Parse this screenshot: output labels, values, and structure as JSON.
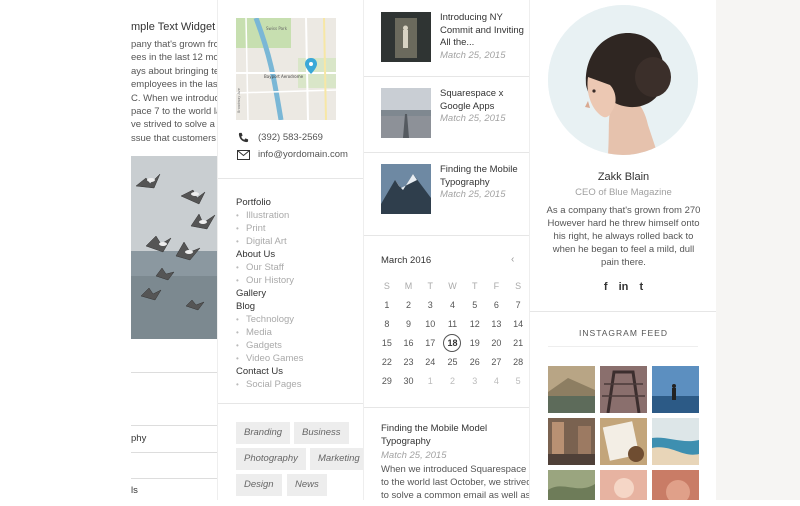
{
  "widget": {
    "title": "mple Text Widget",
    "lines": [
      "pany that's grown fro",
      "ees in the last 12 mo",
      "ays about bringing te",
      "employees in the last",
      "C. When we introduc",
      "pace 7 to the world las",
      "ve strived to solve a",
      "ssue that customers"
    ]
  },
  "left_rows": [
    "",
    "phy",
    "",
    "ls"
  ],
  "contact": {
    "phone": "(392) 583-2569",
    "email": "info@yordomain.com"
  },
  "map_labels": {
    "park": "Swiss Park",
    "airport": "Bayport Aerodrome",
    "road": "Broadway Ave"
  },
  "menu": [
    {
      "label": "Portfolio",
      "type": "main"
    },
    {
      "label": "Illustration",
      "type": "sub"
    },
    {
      "label": "Print",
      "type": "sub"
    },
    {
      "label": "Digital Art",
      "type": "sub"
    },
    {
      "label": "About Us",
      "type": "main"
    },
    {
      "label": "Our Staff",
      "type": "sub"
    },
    {
      "label": "Our History",
      "type": "sub"
    },
    {
      "label": "Gallery",
      "type": "main"
    },
    {
      "label": "Blog",
      "type": "main"
    },
    {
      "label": "Technology",
      "type": "sub"
    },
    {
      "label": "Media",
      "type": "sub"
    },
    {
      "label": "Gadgets",
      "type": "sub"
    },
    {
      "label": "Video Games",
      "type": "sub"
    },
    {
      "label": "Contact Us",
      "type": "main"
    },
    {
      "label": "Social Pages",
      "type": "sub"
    }
  ],
  "tags": [
    "Branding",
    "Business",
    "Photography",
    "Marketing",
    "Design",
    "News"
  ],
  "posts": [
    {
      "title": "Introducing NY Commit and Inviting All the...",
      "date": "Match 25, 2015"
    },
    {
      "title": "Squarespace x Google Apps",
      "date": "Match 25, 2015"
    },
    {
      "title": "Finding the Mobile Typography",
      "date": "Match 25, 2015"
    }
  ],
  "calendar": {
    "title": "March 2016",
    "prev": "‹",
    "days": [
      "S",
      "M",
      "T",
      "W",
      "T",
      "F",
      "S"
    ],
    "weeks": [
      [
        "1",
        "2",
        "3",
        "4",
        "5",
        "6",
        "7"
      ],
      [
        "8",
        "9",
        "10",
        "11",
        "12",
        "13",
        "14"
      ],
      [
        "15",
        "16",
        "17",
        "18",
        "19",
        "20",
        "21"
      ],
      [
        "22",
        "23",
        "24",
        "25",
        "26",
        "27",
        "28"
      ],
      [
        "29",
        "30",
        "1",
        "2",
        "3",
        "4",
        "5"
      ]
    ],
    "today": "18"
  },
  "article": {
    "title": "Finding the Mobile Model Typography",
    "date": "Match 25, 2015",
    "lines": [
      "When we introduced Squarespace 7",
      "to the world last October, we strived",
      "to solve a common email as well as"
    ]
  },
  "profile": {
    "name": "Zakk Blain",
    "role": "CEO of Blue Magazine",
    "bio": [
      "As a company that's grown from 270",
      "However hard he threw himself onto",
      "his right, he always rolled back to",
      "when he began to feel a mild, dull",
      "pain there."
    ],
    "social": [
      "f",
      "in",
      "t"
    ]
  },
  "instagram": {
    "title": "INSTAGRAM FEED"
  },
  "colors": {
    "accent": "#3aa8d8",
    "tag_bg": "#ededed"
  }
}
